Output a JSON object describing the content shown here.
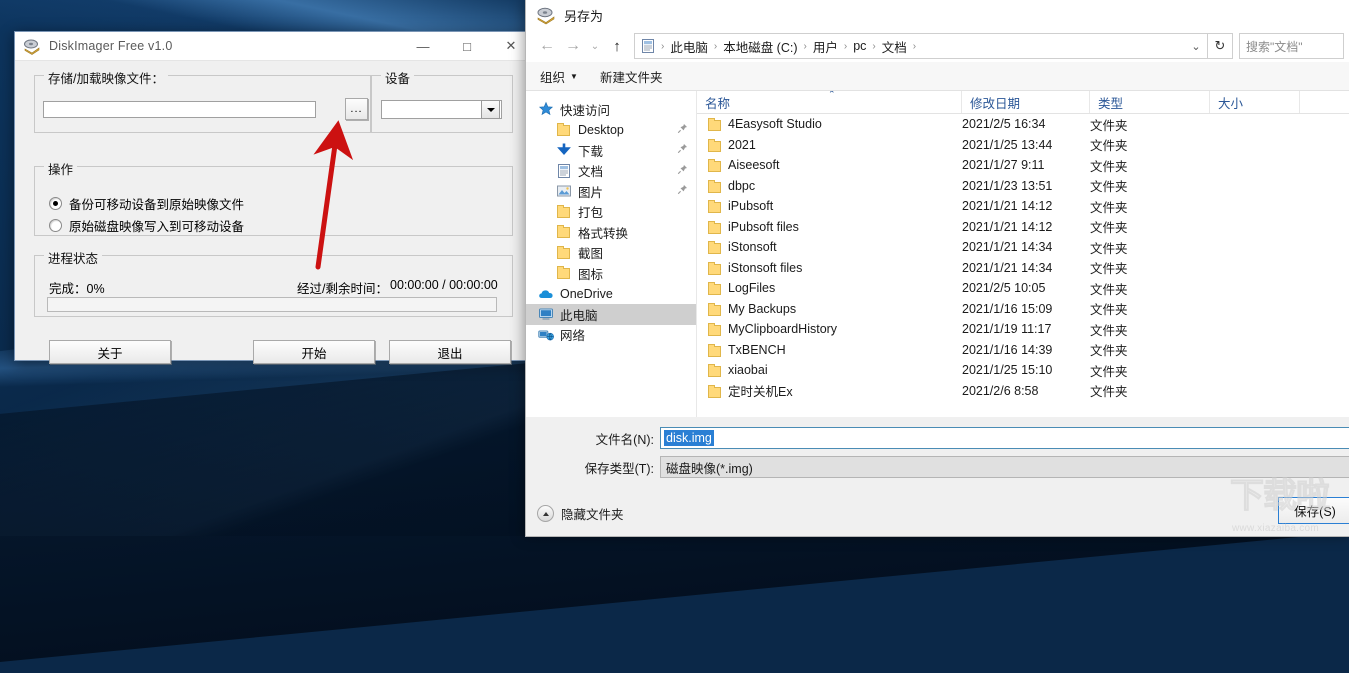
{
  "diskimager": {
    "title": "DiskImager Free v1.0",
    "icon": "disk-icon",
    "window_buttons": {
      "minimize": "—",
      "maximize": "□",
      "close": "✕"
    },
    "group_file": {
      "legend": "存储/加载映像文件：",
      "path_value": "",
      "browse_label": "..."
    },
    "group_device": {
      "legend": "设备",
      "selected": ""
    },
    "group_action": {
      "legend": "操作",
      "options": [
        {
          "label": "备份可移动设备到原始映像文件",
          "checked": true
        },
        {
          "label": "原始磁盘映像写入到可移动设备",
          "checked": false
        }
      ]
    },
    "group_progress": {
      "legend": "进程状态",
      "done_label": "完成：0%",
      "time_label": "经过/剩余时间：",
      "time_value": "00:00:00 / 00:00:00",
      "progress_percent": 0
    },
    "buttons": {
      "about": "关于",
      "start": "开始",
      "exit": "退出"
    },
    "annotation": {
      "type": "red-arrow",
      "color": "#cc1111"
    }
  },
  "saveas": {
    "title": "另存为",
    "title_icon": "save-disk-icon",
    "nav": {
      "back": "←",
      "forward": "→",
      "recent": "⌄",
      "up": "↑",
      "crumb_icon": "documents-icon",
      "breadcrumbs": [
        "此电脑",
        "本地磁盘 (C:)",
        "用户",
        "pc",
        "文档"
      ],
      "separator": "›",
      "dropdown": "⌄",
      "refresh": "↻",
      "search_placeholder": "搜索\"文档\""
    },
    "toolbar": {
      "organize": "组织",
      "organize_caret": "▼",
      "new_folder": "新建文件夹"
    },
    "sidebar": [
      {
        "label": "快速访问",
        "icon": "star-icon",
        "level": 0,
        "pin": "",
        "selected": false
      },
      {
        "label": "Desktop",
        "icon": "folder-icon",
        "level": 1,
        "pin": "📌",
        "selected": false
      },
      {
        "label": "下载",
        "icon": "download-icon",
        "level": 1,
        "pin": "📌",
        "selected": false
      },
      {
        "label": "文档",
        "icon": "documents-icon",
        "level": 1,
        "pin": "📌",
        "selected": false
      },
      {
        "label": "图片",
        "icon": "pictures-icon",
        "level": 1,
        "pin": "📌",
        "selected": false
      },
      {
        "label": "打包",
        "icon": "folder-icon",
        "level": 1,
        "pin": "",
        "selected": false
      },
      {
        "label": "格式转换",
        "icon": "folder-icon",
        "level": 1,
        "pin": "",
        "selected": false
      },
      {
        "label": "截图",
        "icon": "folder-icon",
        "level": 1,
        "pin": "",
        "selected": false
      },
      {
        "label": "图标",
        "icon": "folder-icon",
        "level": 1,
        "pin": "",
        "selected": false
      },
      {
        "label": "OneDrive",
        "icon": "cloud-icon",
        "level": 0,
        "pin": "",
        "selected": false
      },
      {
        "label": "此电脑",
        "icon": "computer-icon",
        "level": 0,
        "pin": "",
        "selected": true
      },
      {
        "label": "网络",
        "icon": "network-icon",
        "level": 0,
        "pin": "",
        "selected": false
      }
    ],
    "columns": [
      "名称",
      "修改日期",
      "类型",
      "大小"
    ],
    "sort_indicator": "⌃",
    "rows": [
      {
        "name": "4Easysoft Studio",
        "date": "2021/2/5 16:34",
        "type": "文件夹",
        "size": ""
      },
      {
        "name": "2021",
        "date": "2021/1/25 13:44",
        "type": "文件夹",
        "size": ""
      },
      {
        "name": "Aiseesoft",
        "date": "2021/1/27 9:11",
        "type": "文件夹",
        "size": ""
      },
      {
        "name": "dbpc",
        "date": "2021/1/23 13:51",
        "type": "文件夹",
        "size": ""
      },
      {
        "name": "iPubsoft",
        "date": "2021/1/21 14:12",
        "type": "文件夹",
        "size": ""
      },
      {
        "name": "iPubsoft files",
        "date": "2021/1/21 14:12",
        "type": "文件夹",
        "size": ""
      },
      {
        "name": "iStonsoft",
        "date": "2021/1/21 14:34",
        "type": "文件夹",
        "size": ""
      },
      {
        "name": "iStonsoft files",
        "date": "2021/1/21 14:34",
        "type": "文件夹",
        "size": ""
      },
      {
        "name": "LogFiles",
        "date": "2021/2/5 10:05",
        "type": "文件夹",
        "size": ""
      },
      {
        "name": "My Backups",
        "date": "2021/1/16 15:09",
        "type": "文件夹",
        "size": ""
      },
      {
        "name": "MyClipboardHistory",
        "date": "2021/1/19 11:17",
        "type": "文件夹",
        "size": ""
      },
      {
        "name": "TxBENCH",
        "date": "2021/1/16 14:39",
        "type": "文件夹",
        "size": ""
      },
      {
        "name": "xiaobai",
        "date": "2021/1/25 15:10",
        "type": "文件夹",
        "size": ""
      },
      {
        "name": "定时关机Ex",
        "date": "2021/2/6 8:58",
        "type": "文件夹",
        "size": ""
      }
    ],
    "filename": {
      "label": "文件名(N):",
      "value": "disk.img"
    },
    "filetype": {
      "label": "保存类型(T):",
      "value": "磁盘映像(*.img)"
    },
    "hide_folders": "隐藏文件夹",
    "save_button": "保存(S)"
  },
  "watermark": {
    "big": "下载啦",
    "url": "www.xiazaiba.com"
  }
}
